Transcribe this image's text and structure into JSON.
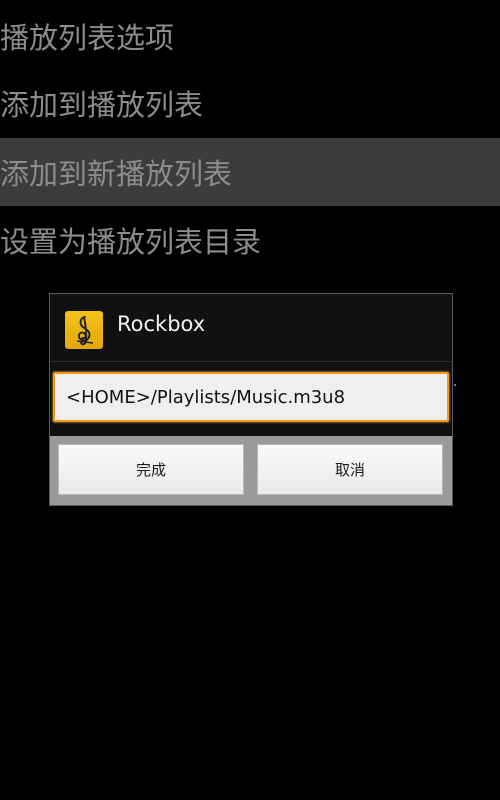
{
  "menu": {
    "items": [
      {
        "label": "播放列表选项"
      },
      {
        "label": "添加到播放列表"
      },
      {
        "label": "添加到新播放列表"
      },
      {
        "label": "设置为播放列表目录"
      }
    ],
    "selected_index": 2
  },
  "dialog": {
    "title": "Rockbox",
    "icon": "treble-clef-icon",
    "input_value": "<HOME>/Playlists/Music.m3u8",
    "ok_label": "完成",
    "cancel_label": "取消"
  },
  "colors": {
    "background": "#000000",
    "menu_text": "#8c8c8c",
    "selected_row": "#3c3c3c",
    "input_focus_border": "#f39a18",
    "app_icon": "#f4c21c"
  }
}
